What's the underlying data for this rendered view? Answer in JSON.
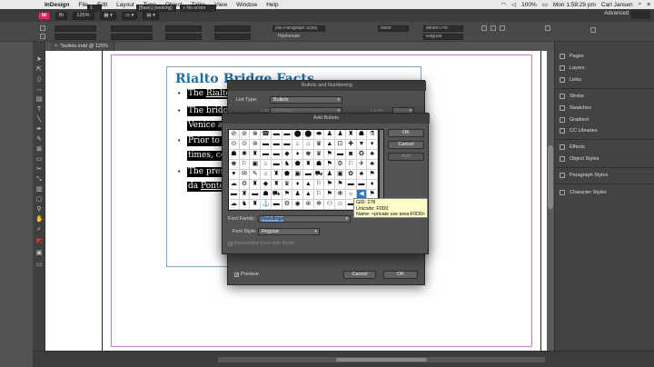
{
  "menubar": {
    "apple_glyph": "",
    "items": [
      "InDesign",
      "File",
      "Edit",
      "Layout",
      "Type",
      "Object",
      "Table",
      "View",
      "Window",
      "Help"
    ],
    "battery": "100%",
    "clock": "Mon 1:58:29 pm",
    "user": "Carl Jansen"
  },
  "appbar": {
    "logo": "Id",
    "zoom": "125%",
    "workspace": "Advanced"
  },
  "control": {
    "paragraph_style": "[No Paragraph Style]",
    "hyphenate_label": "Hyphenate",
    "font": "Minion Pro",
    "style": "Regular",
    "none_label": "None"
  },
  "document": {
    "tab_label": "*bullets.indd @ 125%",
    "heading": "Rialto Bridge Facts",
    "lines": [
      {
        "pre": "The ",
        "link": "Rialto",
        "post": ""
      },
      {
        "pre": "The bridg",
        "link": "",
        "post": ""
      },
      {
        "pre": "Venice ar",
        "link": "",
        "post": ""
      },
      {
        "pre": "Prior to t",
        "link": "",
        "post": ""
      },
      {
        "pre": "times, co",
        "link": "",
        "post": ""
      },
      {
        "pre": "The prese",
        "link": "",
        "post": ""
      },
      {
        "pre": "da ",
        "link": "Ponte",
        "post": ""
      }
    ]
  },
  "panels": [
    "Pages",
    "Layers",
    "Links",
    "Stroke",
    "Swatches",
    "Gradient",
    "CC Libraries",
    "Effects",
    "Object Styles",
    "Paragraph Styles",
    "Character Styles"
  ],
  "statusbar": {
    "page": "1",
    "style": "[Basic] (working)",
    "errors": "No errors"
  },
  "bullets_dialog": {
    "title": "Bullets and Numbering",
    "list_type_label": "List Type:",
    "list_type_value": "Bullets",
    "list_label": "List:",
    "list_value": "[Default]",
    "level_label": "Level:",
    "preview_label": "Preview",
    "cancel_label": "Cancel",
    "ok_label": "OK"
  },
  "add_bullets_dialog": {
    "title": "Add Bullets",
    "ok_label": "OK",
    "cancel_label": "Cancel",
    "add_label": "Add",
    "font_family_label": "Font Family:",
    "font_family_value": "Webdings",
    "font_style_label": "Font Style:",
    "font_style_value": "Regular",
    "remember_label": "Remember Font with Bullet",
    "glyphs": [
      "⊘",
      "⊘",
      "⊗",
      "☎",
      "▬",
      "▬",
      "⬤",
      "⬤",
      "⬬",
      "♟",
      "♟",
      "♜",
      "☗",
      "⚗",
      "⊙",
      "⊙",
      "⊚",
      "▬",
      "▬",
      "▬",
      "⌂",
      "⌂",
      "♛",
      "▲",
      "⊡",
      "✚",
      "▼",
      "▾",
      "☗",
      "✱",
      "♜",
      "▬",
      "▬",
      "◆",
      "♦",
      "♚",
      "♛",
      "⚑",
      "▬",
      "◙",
      "✪",
      "♣",
      "♚",
      "⚐",
      "▣",
      "⌂",
      "▬",
      "♞",
      "⬟",
      "♜",
      "☗",
      "⚑",
      "⚙",
      "⚐",
      "✈",
      "♣",
      "♥",
      "✉",
      "✎",
      "⌂",
      "♜",
      "⬟",
      "▣",
      "▬",
      "⛟",
      "♟",
      "▣",
      "✿",
      "♣",
      "⚑",
      "☁",
      "⚙",
      "♜",
      "◆",
      "♜",
      "♛",
      "♦",
      "▲",
      "⚐",
      "⚑",
      "⚑",
      "▬",
      "▬",
      "♦",
      "▬",
      "♜",
      "▬",
      "☗",
      "⛟",
      "⚑",
      "♟",
      "▲",
      "⚐",
      "⚑",
      "✻",
      "☼",
      "◀",
      "⚑",
      "☁",
      "♞",
      "♜",
      "⚓",
      "▬",
      "⚙",
      "◉",
      "⊛",
      "❄",
      "⚇",
      "☺",
      "▬",
      "◉",
      "◉"
    ],
    "selected_glyph_index": 96,
    "tooltip": {
      "gid": "GID: 178",
      "unicode": "Unicode: F0D0",
      "name": "Name: <private use area-F0D0>"
    }
  }
}
